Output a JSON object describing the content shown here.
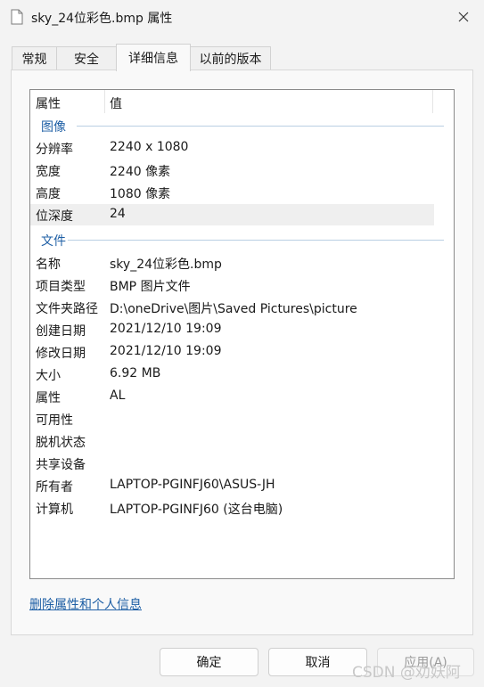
{
  "window": {
    "title": "sky_24位彩色.bmp 属性",
    "close_icon": "close-icon",
    "file_icon": "file-icon"
  },
  "tabs": [
    {
      "label": "常规",
      "active": false
    },
    {
      "label": "安全",
      "active": false
    },
    {
      "label": "详细信息",
      "active": true
    },
    {
      "label": "以前的版本",
      "active": false
    }
  ],
  "details": {
    "header": {
      "name": "属性",
      "value": "值"
    },
    "groups": {
      "image": {
        "label": "图像"
      },
      "file": {
        "label": "文件"
      }
    },
    "image_rows": [
      {
        "name": "分辨率",
        "value": "2240 x 1080"
      },
      {
        "name": "宽度",
        "value": "2240 像素"
      },
      {
        "name": "高度",
        "value": "1080 像素"
      },
      {
        "name": "位深度",
        "value": "24"
      }
    ],
    "file_rows": [
      {
        "name": "名称",
        "value": "sky_24位彩色.bmp"
      },
      {
        "name": "项目类型",
        "value": "BMP 图片文件"
      },
      {
        "name": "文件夹路径",
        "value": "D:\\oneDrive\\图片\\Saved Pictures\\picture"
      },
      {
        "name": "创建日期",
        "value": "2021/12/10 19:09"
      },
      {
        "name": "修改日期",
        "value": "2021/12/10 19:09"
      },
      {
        "name": "大小",
        "value": "6.92 MB"
      },
      {
        "name": "属性",
        "value": "AL"
      },
      {
        "name": "可用性",
        "value": ""
      },
      {
        "name": "脱机状态",
        "value": ""
      },
      {
        "name": "共享设备",
        "value": ""
      },
      {
        "name": "所有者",
        "value": "LAPTOP-PGINFJ60\\ASUS-JH"
      },
      {
        "name": "计算机",
        "value": "LAPTOP-PGINFJ60 (这台电脑)"
      }
    ]
  },
  "remove_link": "删除属性和个人信息",
  "buttons": {
    "ok": "确定",
    "cancel": "取消",
    "apply": "应用(A)"
  },
  "watermark": "CSDN @劝妖阿",
  "colors": {
    "link": "#1e5fa5",
    "group_line": "#b9cfe3",
    "selected_row": "#efefef"
  }
}
